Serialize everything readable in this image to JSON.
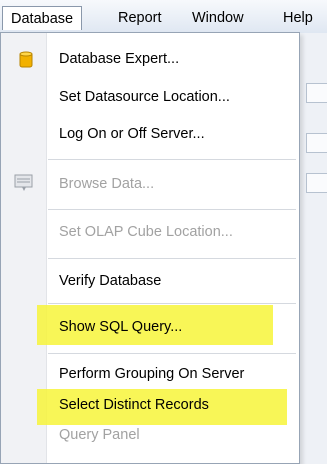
{
  "menubar": {
    "items": [
      {
        "label": "Database"
      },
      {
        "label": "Report"
      },
      {
        "label": "Window"
      },
      {
        "label": "Help"
      }
    ]
  },
  "menu": {
    "items": [
      {
        "label": "Database Expert...",
        "icon": "database-icon",
        "enabled": true
      },
      {
        "label": "Set Datasource Location...",
        "enabled": true
      },
      {
        "label": "Log On or Off Server...",
        "enabled": true
      },
      {
        "label": "Browse Data...",
        "icon": "browse-data-icon",
        "enabled": false
      },
      {
        "label": "Set OLAP Cube Location...",
        "enabled": false
      },
      {
        "label": "Verify Database",
        "enabled": true
      },
      {
        "label": "Show SQL Query...",
        "enabled": true,
        "highlighted": true
      },
      {
        "label": "Perform Grouping On Server",
        "enabled": true
      },
      {
        "label": "Select Distinct Records",
        "enabled": true,
        "highlighted": true
      },
      {
        "label": "Query Panel",
        "enabled": false
      }
    ]
  },
  "colors": {
    "highlight": "#f7f43a",
    "disabled_text": "#a2a2a2",
    "menu_border": "#97a4b5",
    "gutter": "#f1f2f5"
  }
}
